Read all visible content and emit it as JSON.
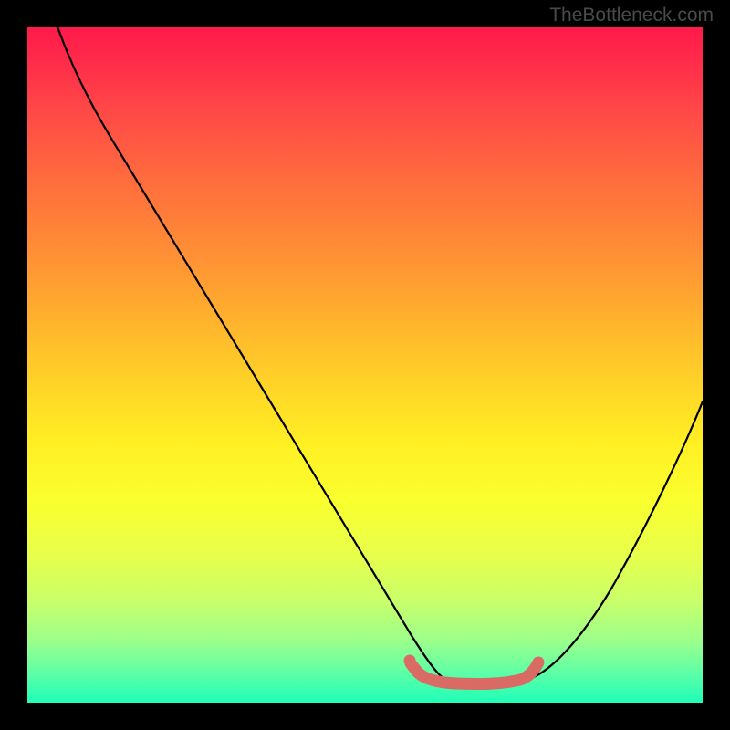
{
  "watermark": "TheBottleneck.com",
  "chart_data": {
    "type": "line",
    "title": "",
    "xlabel": "",
    "ylabel": "",
    "xlim": [
      0,
      100
    ],
    "ylim": [
      0,
      100
    ],
    "grid": false,
    "series": [
      {
        "name": "bottleneck-curve",
        "x": [
          0,
          5,
          10,
          15,
          20,
          25,
          30,
          35,
          40,
          45,
          50,
          55,
          60,
          65,
          70,
          75,
          80,
          85,
          90,
          95,
          100
        ],
        "y": [
          115,
          100,
          91,
          82,
          73,
          64,
          55,
          46,
          37,
          28,
          19,
          10,
          3,
          0,
          0,
          1,
          7,
          17,
          28,
          39,
          50
        ],
        "color": "#000000"
      },
      {
        "name": "highlight-segment",
        "x": [
          57,
          62,
          68,
          72,
          75
        ],
        "y": [
          3.2,
          2.6,
          2.5,
          2.7,
          4.5
        ],
        "color": "#d96a64"
      }
    ],
    "markers": [
      {
        "x": 57,
        "y": 3.8,
        "color": "#d96a64",
        "size": 6
      }
    ],
    "background_gradient": {
      "top": "#ff1a4a",
      "middle": "#fff024",
      "bottom": "#1fffb8"
    }
  }
}
